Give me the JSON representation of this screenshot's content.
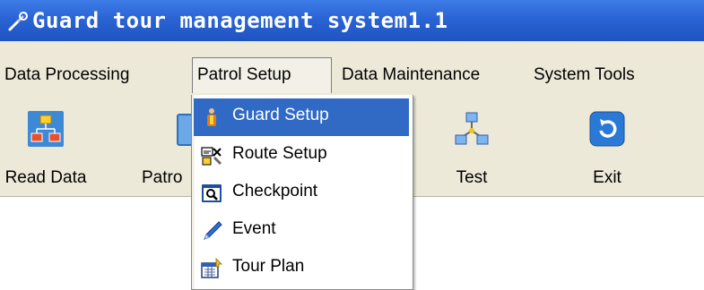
{
  "window": {
    "title": "Guard tour management system1.1",
    "title_icon": "wrench-icon"
  },
  "menubar": {
    "items": [
      {
        "label": "Data Processing"
      },
      {
        "label": "Patrol Setup",
        "active": true
      },
      {
        "label": "Data Maintenance"
      },
      {
        "label": "System Tools"
      }
    ]
  },
  "toolbar": {
    "items": [
      {
        "label": "Read Data",
        "icon": "flowchart-icon"
      },
      {
        "label": "Patro",
        "icon": "document-icon"
      },
      {
        "label": "Test",
        "icon": "network-icon"
      },
      {
        "label": "Exit",
        "icon": "exit-icon"
      }
    ]
  },
  "dropdown": {
    "items": [
      {
        "label": "Guard Setup",
        "icon": "guard-icon",
        "highlighted": true
      },
      {
        "label": "Route Setup",
        "icon": "route-icon"
      },
      {
        "label": "Checkpoint",
        "icon": "checkpoint-icon"
      },
      {
        "label": "Event",
        "icon": "pen-icon"
      },
      {
        "label": "Tour Plan",
        "icon": "calendar-icon"
      }
    ]
  },
  "colors": {
    "titlebar": "#2a64d4",
    "highlight": "#316ac5",
    "face": "#ece9d8"
  }
}
